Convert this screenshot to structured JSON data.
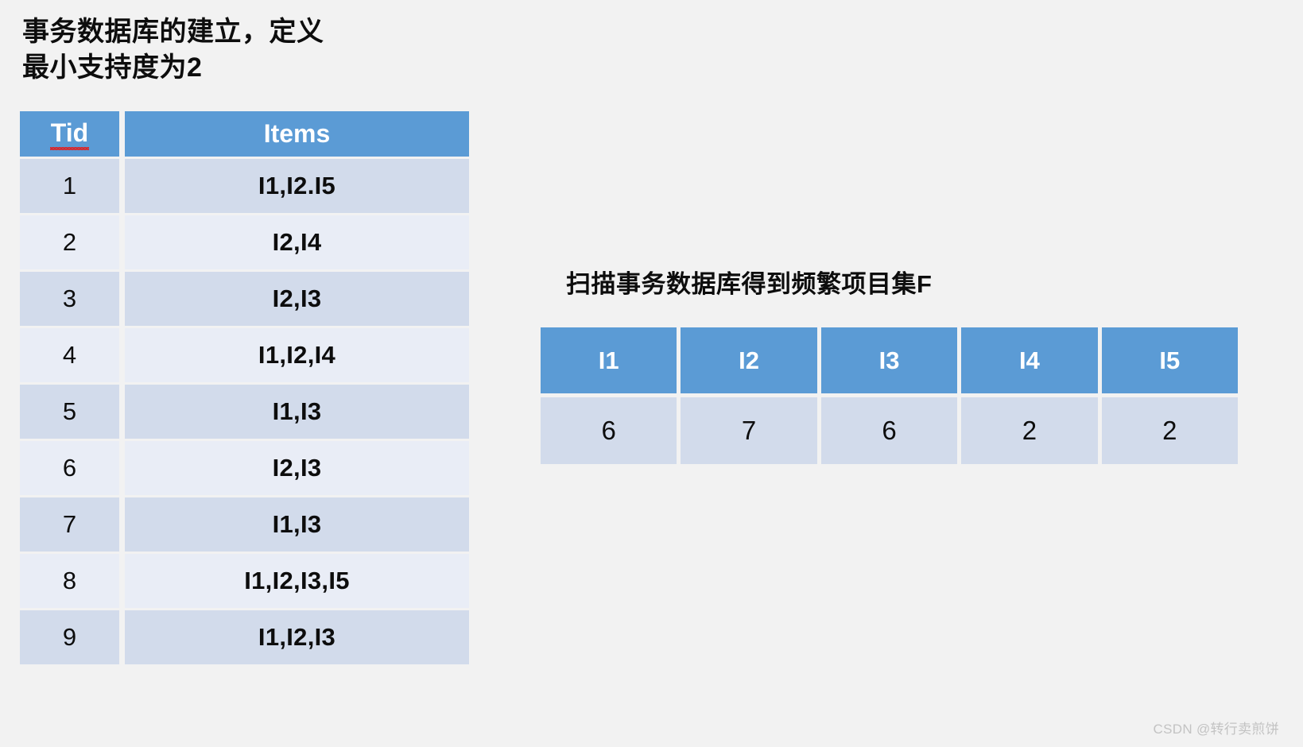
{
  "page": {
    "background_color": "#f2f2f2",
    "accent_color": "#5b9bd5",
    "band_dark_color": "#d2dbeb",
    "band_light_color": "#e9edf6"
  },
  "left_section": {
    "title": "事务数据库的建立，定义\n最小支持度为2",
    "table": {
      "headers": {
        "tid": "Tid",
        "items": "Items"
      },
      "rows": [
        {
          "tid": "1",
          "items": "I1,I2.I5"
        },
        {
          "tid": "2",
          "items": "I2,I4"
        },
        {
          "tid": "3",
          "items": "I2,I3"
        },
        {
          "tid": "4",
          "items": "I1,I2,I4"
        },
        {
          "tid": "5",
          "items": "I1,I3"
        },
        {
          "tid": "6",
          "items": "I2,I3"
        },
        {
          "tid": "7",
          "items": "I1,I3"
        },
        {
          "tid": "8",
          "items": "I1,I2,I3,I5"
        },
        {
          "tid": "9",
          "items": "I1,I2,I3"
        }
      ]
    }
  },
  "right_section": {
    "title": "扫描事务数据库得到频繁项目集F",
    "table": {
      "headers": [
        "I1",
        "I2",
        "I3",
        "I4",
        "I5"
      ],
      "values": [
        "6",
        "7",
        "6",
        "2",
        "2"
      ]
    }
  },
  "watermark": {
    "text": "CSDN @转行卖煎饼"
  }
}
